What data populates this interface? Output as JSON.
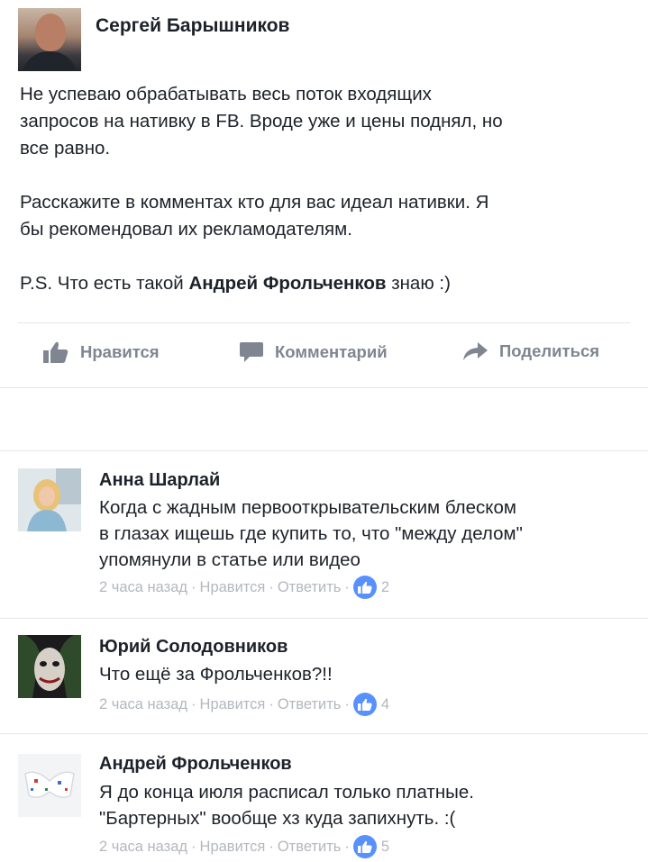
{
  "post": {
    "author": "Сергей Барышников",
    "text_lines_1": [
      "Не успеваю обрабатывать весь поток входящих",
      "запросов на нативку в FB. Вроде уже и цены поднял, но",
      "все равно."
    ],
    "text_lines_2": [
      "Расскажите в комментах кто для вас идеал нативки. Я",
      "бы рекомендовал их рекламодателям."
    ],
    "ps_prefix": "P.S. Что есть такой ",
    "ps_name": "Андрей Фрольченков",
    "ps_suffix": " знаю :)"
  },
  "actions": {
    "like": "Нравится",
    "comment": "Комментарий",
    "share": "Поделиться"
  },
  "meta_labels": {
    "like": "Нравится",
    "reply": "Ответить",
    "separator": "·"
  },
  "comments": [
    {
      "author": "Анна Шарлай",
      "lines": [
        "Когда с жадным первооткрывательским блеском",
        "в глазах ищешь где купить то, что \"между делом\"",
        "упомянули в статье или видео"
      ],
      "time": "2 часа назад",
      "likes": "2"
    },
    {
      "author": "Юрий Солодовников",
      "lines": [
        "Что ещё за Фрольченков?!!"
      ],
      "time": "2 часа назад",
      "likes": "4"
    },
    {
      "author": "Андрей Фрольченков",
      "lines": [
        "Я до конца июля расписал только платные.",
        "\"Бартерных\" вообще хз куда запихнуть. :("
      ],
      "time": "2 часа назад",
      "likes": "5"
    }
  ],
  "colors": {
    "text": "#1d2129",
    "muted": "#7f8591",
    "meta": "#b3b7bf",
    "like_blue": "#5890ff",
    "divider": "#e5e6e9"
  }
}
